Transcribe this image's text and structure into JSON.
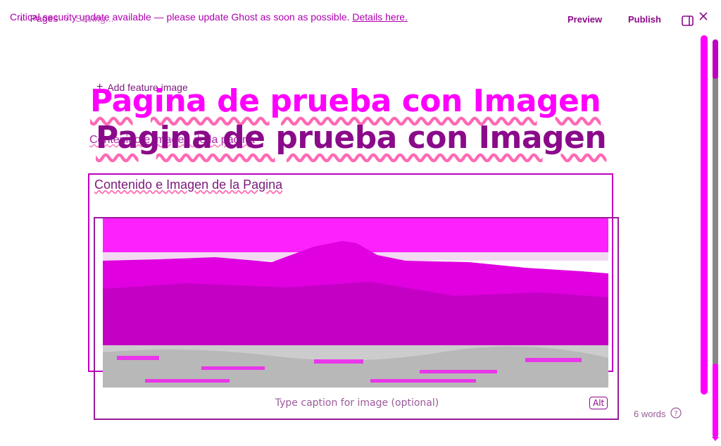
{
  "banner": {
    "message": "Critical security update available — please update Ghost as soon as possible.",
    "link": "Details here."
  },
  "breadcrumb": {
    "back_arrow": "‹",
    "parent": "Pages",
    "separator": "›",
    "status": "Saving..."
  },
  "toolbar": {
    "preview_label": "Preview",
    "publish_label": "Publish",
    "sidebar_icon": "sidebar-toggle-icon",
    "close_icon": "close-icon"
  },
  "editor": {
    "feature_image_label": "Add feature image",
    "title_ghost": "Pagina de prueba con Imagen",
    "title": "Pagina de prueba con Imagen",
    "excerpt": "Contenido e imagen de la pagina",
    "body_text": "Contenido e Imagen de la Pagina",
    "caption_placeholder": "Type caption for image (optional)",
    "alt_label": "Alt",
    "word_count": "6 words",
    "help_icon": "help-icon"
  },
  "colors": {
    "accent": "#ff00ff",
    "text": "#8a0a8a",
    "image_mountain": "#e000e0"
  }
}
